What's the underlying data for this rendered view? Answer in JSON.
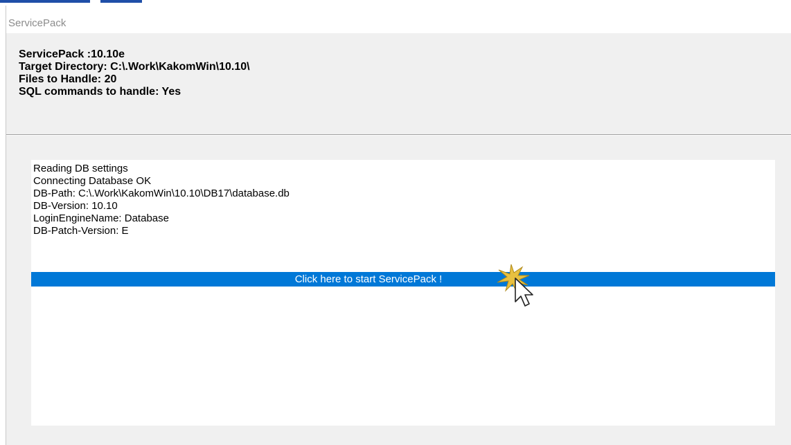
{
  "window": {
    "title": "ServicePack"
  },
  "header": {
    "servicepack": "ServicePack :10.10e",
    "target_directory": "Target Directory: C:\\.Work\\KakomWin\\10.10\\",
    "files_to_handle": "Files to Handle: 20",
    "sql_commands": "SQL commands to handle: Yes"
  },
  "log": {
    "lines": [
      "Reading DB settings",
      "Connecting Database   OK",
      "DB-Path: C:\\.Work\\KakomWin\\10.10\\DB17\\database.db",
      "DB-Version: 10.10",
      "LoginEngineName: Database",
      "DB-Patch-Version: E"
    ]
  },
  "actions": {
    "start_label": "Click here to start ServicePack !"
  },
  "colors": {
    "accent": "#0078d7",
    "background": "#f0f0f0",
    "panel": "#ffffff",
    "click_highlight": "#e8c040"
  },
  "icons": {
    "cursor": "mouse-pointer-icon",
    "click": "click-burst-icon"
  }
}
